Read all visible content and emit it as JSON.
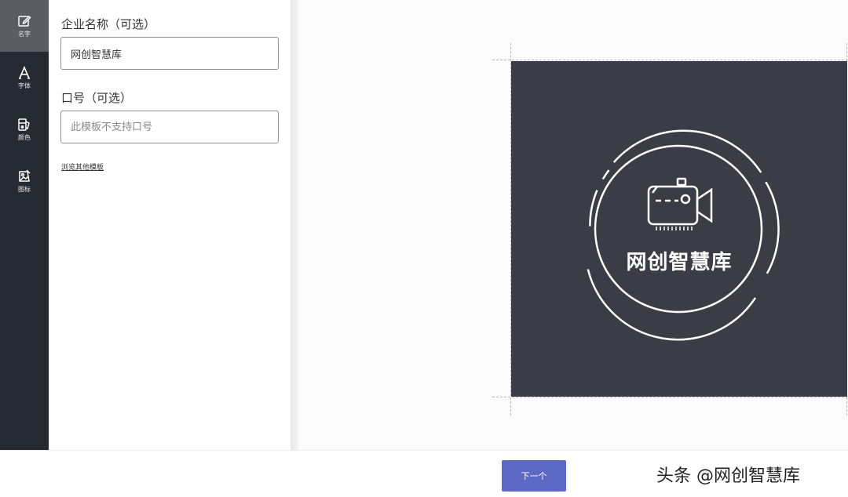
{
  "sidebar": {
    "items": [
      {
        "label": "名字",
        "icon": "edit-icon",
        "active": true
      },
      {
        "label": "字体",
        "icon": "font-icon",
        "active": false
      },
      {
        "label": "颜色",
        "icon": "color-icon",
        "active": false
      },
      {
        "label": "图标",
        "icon": "image-icon",
        "active": false
      }
    ]
  },
  "form": {
    "company_label": "企业名称（可选）",
    "company_value": "网创智慧库",
    "slogan_label": "口号（可选）",
    "slogan_placeholder": "此模板不支持口号",
    "browse_link": "浏览其他模板"
  },
  "preview": {
    "logo_text": "网创智慧库",
    "background_color": "#3c3c46",
    "foreground_color": "#ffffff",
    "icon": "video-camera-icon"
  },
  "footer": {
    "next_label": "下一个",
    "watermark": "头条 @网创智慧库"
  },
  "colors": {
    "sidebar_bg": "#262a33",
    "accent": "#5d68c4"
  }
}
